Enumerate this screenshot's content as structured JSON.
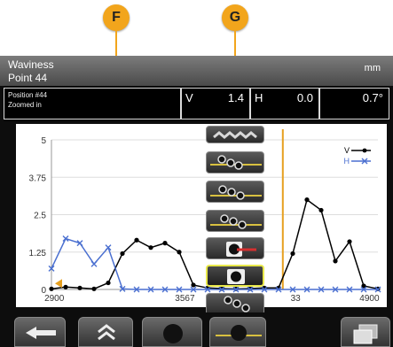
{
  "callouts": {
    "f": "F",
    "g": "G"
  },
  "header": {
    "title": "Waviness",
    "subtitle": "Point 44",
    "unit": "mm"
  },
  "info": {
    "position": "Position #44",
    "mode": "Zoomed in",
    "v_label": "V",
    "v_value": "1.4",
    "h_label": "H",
    "h_value": "0.0",
    "angle": "0.7°"
  },
  "toolbar": {
    "icons": [
      "waviness-zigzag-icon",
      "dots-line-icon",
      "dots-line-icon",
      "dots-line-icon",
      "point-marker-icon",
      "record-point-icon",
      "dots-curve-icon"
    ],
    "selected_index": 5
  },
  "bottom_nav": {
    "icons": [
      "back-arrow-icon",
      "chevron-up-icon",
      "point-icon",
      "point-line-icon",
      "copy-windows-icon"
    ]
  },
  "colors": {
    "v_series": "#000000",
    "h_series": "#4a6fd0",
    "cursor": "#e6a020",
    "accent": "#f2a51c"
  },
  "chart_data": {
    "type": "line",
    "x_tick_labels": [
      "2900",
      "3567",
      "33",
      "4900"
    ],
    "ylim": [
      0,
      5
    ],
    "y_ticks": [
      "0",
      "1.25",
      "2.5",
      "3.75",
      "5"
    ],
    "grid": true,
    "legend_placement": "top-right",
    "x_index_range": [
      1,
      24
    ],
    "series": [
      {
        "name": "V",
        "color": "#000000",
        "points": [
          [
            1,
            0.02
          ],
          [
            2,
            0.08
          ],
          [
            3,
            0.05
          ],
          [
            4,
            0.02
          ],
          [
            5,
            0.22
          ],
          [
            6,
            1.2
          ],
          [
            7,
            1.65
          ],
          [
            8,
            1.4
          ],
          [
            9,
            1.55
          ],
          [
            10,
            1.25
          ],
          [
            11,
            0.15
          ],
          [
            12,
            0.05
          ],
          [
            13,
            0.03
          ],
          [
            14,
            0.02
          ],
          [
            15,
            0.03
          ],
          [
            16,
            0.05
          ],
          [
            17,
            0.05
          ],
          [
            18,
            1.2
          ],
          [
            19,
            3.0
          ],
          [
            20,
            2.65
          ],
          [
            21,
            0.95
          ],
          [
            22,
            1.6
          ],
          [
            23,
            0.12
          ],
          [
            24,
            0.02
          ]
        ]
      },
      {
        "name": "H",
        "color": "#4a6fd0",
        "points": [
          [
            1,
            0.7
          ],
          [
            2,
            1.7
          ],
          [
            3,
            1.55
          ],
          [
            4,
            0.85
          ],
          [
            5,
            1.4
          ],
          [
            6,
            0.02
          ],
          [
            7,
            0.0
          ],
          [
            8,
            0.0
          ],
          [
            9,
            0.0
          ],
          [
            10,
            0.0
          ],
          [
            11,
            0.0
          ],
          [
            12,
            0.0
          ],
          [
            13,
            0.0
          ],
          [
            14,
            0.0
          ],
          [
            15,
            0.0
          ],
          [
            16,
            0.0
          ],
          [
            17,
            0.0
          ],
          [
            18,
            0.0
          ],
          [
            19,
            0.0
          ],
          [
            20,
            0.0
          ],
          [
            21,
            0.0
          ],
          [
            22,
            0.0
          ],
          [
            23,
            0.0
          ],
          [
            24,
            0.0
          ]
        ]
      }
    ]
  }
}
